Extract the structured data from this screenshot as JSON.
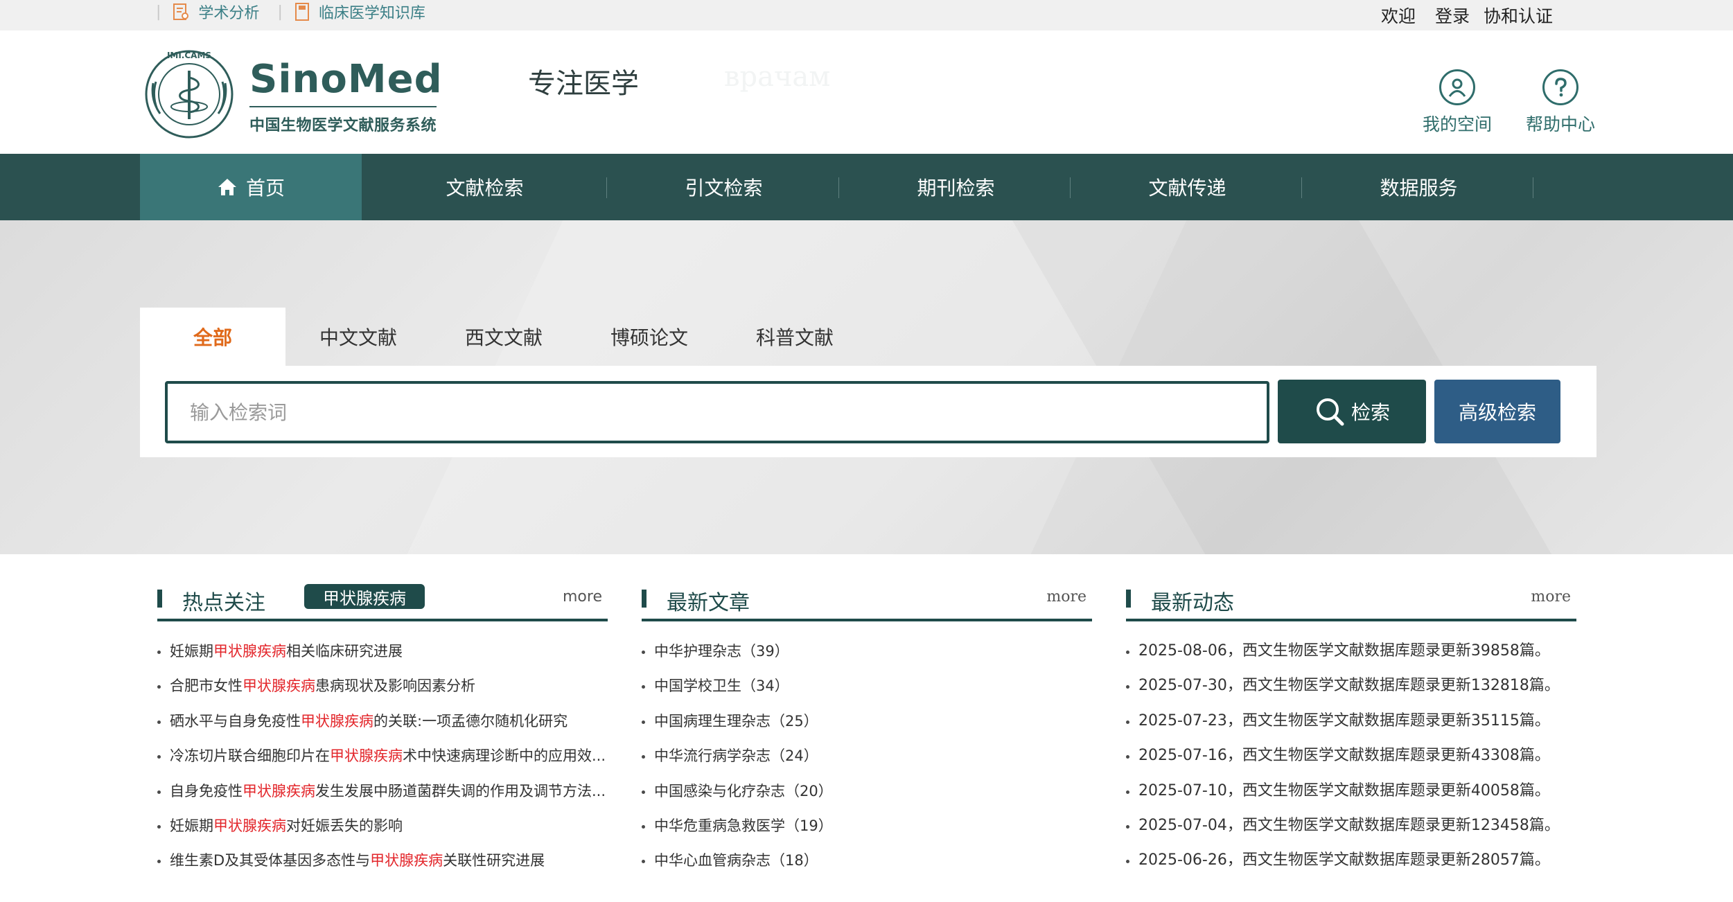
{
  "topbar": {
    "links": [
      {
        "label": "学术分析",
        "icon": "chart-document-icon"
      },
      {
        "label": "临床医学知识库",
        "icon": "book-icon"
      }
    ],
    "auth": {
      "welcome": "欢迎",
      "login": "登录",
      "pumc_auth": "协和认证"
    }
  },
  "header": {
    "logo_title": "SinoMed",
    "logo_subtitle": "中国生物医学文献服务系统",
    "logo_emblem_text": "IMI.CAMS",
    "slogan": "专注医学",
    "slogan_faded": "врачам"
  },
  "header_buttons": {
    "my_space": "我的空间",
    "help_center": "帮助中心"
  },
  "nav": {
    "items": [
      {
        "label": "首页"
      },
      {
        "label": "文献检索"
      },
      {
        "label": "引文检索"
      },
      {
        "label": "期刊检索"
      },
      {
        "label": "文献传递"
      },
      {
        "label": "数据服务"
      }
    ]
  },
  "search": {
    "tabs": [
      "全部",
      "中文文献",
      "西文文献",
      "博硕论文",
      "科普文献"
    ],
    "placeholder": "输入检索词",
    "search_label": "检索",
    "advanced_label": "高级检索"
  },
  "hot": {
    "title": "热点关注",
    "badge": "甲状腺疾病",
    "more": "more",
    "highlight": "甲状腺疾病",
    "items": [
      {
        "pre": "妊娠期",
        "post": "相关临床研究进展"
      },
      {
        "pre": "合肥市女性",
        "post": "患病现状及影响因素分析"
      },
      {
        "pre": "硒水平与自身免疫性",
        "post": "的关联:一项孟德尔随机化研究"
      },
      {
        "pre": "冷冻切片联合细胞印片在",
        "post": "术中快速病理诊断中的应用效..."
      },
      {
        "pre": "自身免疫性",
        "post": "发生发展中肠道菌群失调的作用及调节方法..."
      },
      {
        "pre": "妊娠期",
        "post": "对妊娠丢失的影响"
      },
      {
        "pre": "维生素D及其受体基因多态性与",
        "post": "关联性研究进展"
      }
    ]
  },
  "latest_articles": {
    "title": "最新文章",
    "more": "more",
    "items": [
      "中华护理杂志（39）",
      "中国学校卫生（34）",
      "中国病理生理杂志（25）",
      "中华流行病学杂志（24）",
      "中国感染与化疗杂志（20）",
      "中华危重病急救医学（19）",
      "中华心血管病杂志（18）"
    ]
  },
  "latest_news": {
    "title": "最新动态",
    "more": "more",
    "items": [
      "2025-08-06，西文生物医学文献数据库题录更新39858篇。",
      "2025-07-30，西文生物医学文献数据库题录更新132818篇。",
      "2025-07-23，西文生物医学文献数据库题录更新35115篇。",
      "2025-07-16，西文生物医学文献数据库题录更新43308篇。",
      "2025-07-10，西文生物医学文献数据库题录更新40058篇。",
      "2025-07-04，西文生物医学文献数据库题录更新123458篇。",
      "2025-06-26，西文生物医学文献数据库题录更新28057篇。"
    ]
  },
  "colors": {
    "brand_dark": "#1f4b4a",
    "nav_bg": "#2b5150",
    "nav_active": "#3a7677",
    "accent_orange": "#e06a1b",
    "highlight_red": "#e3262b",
    "advanced_blue": "#2e5d86"
  }
}
